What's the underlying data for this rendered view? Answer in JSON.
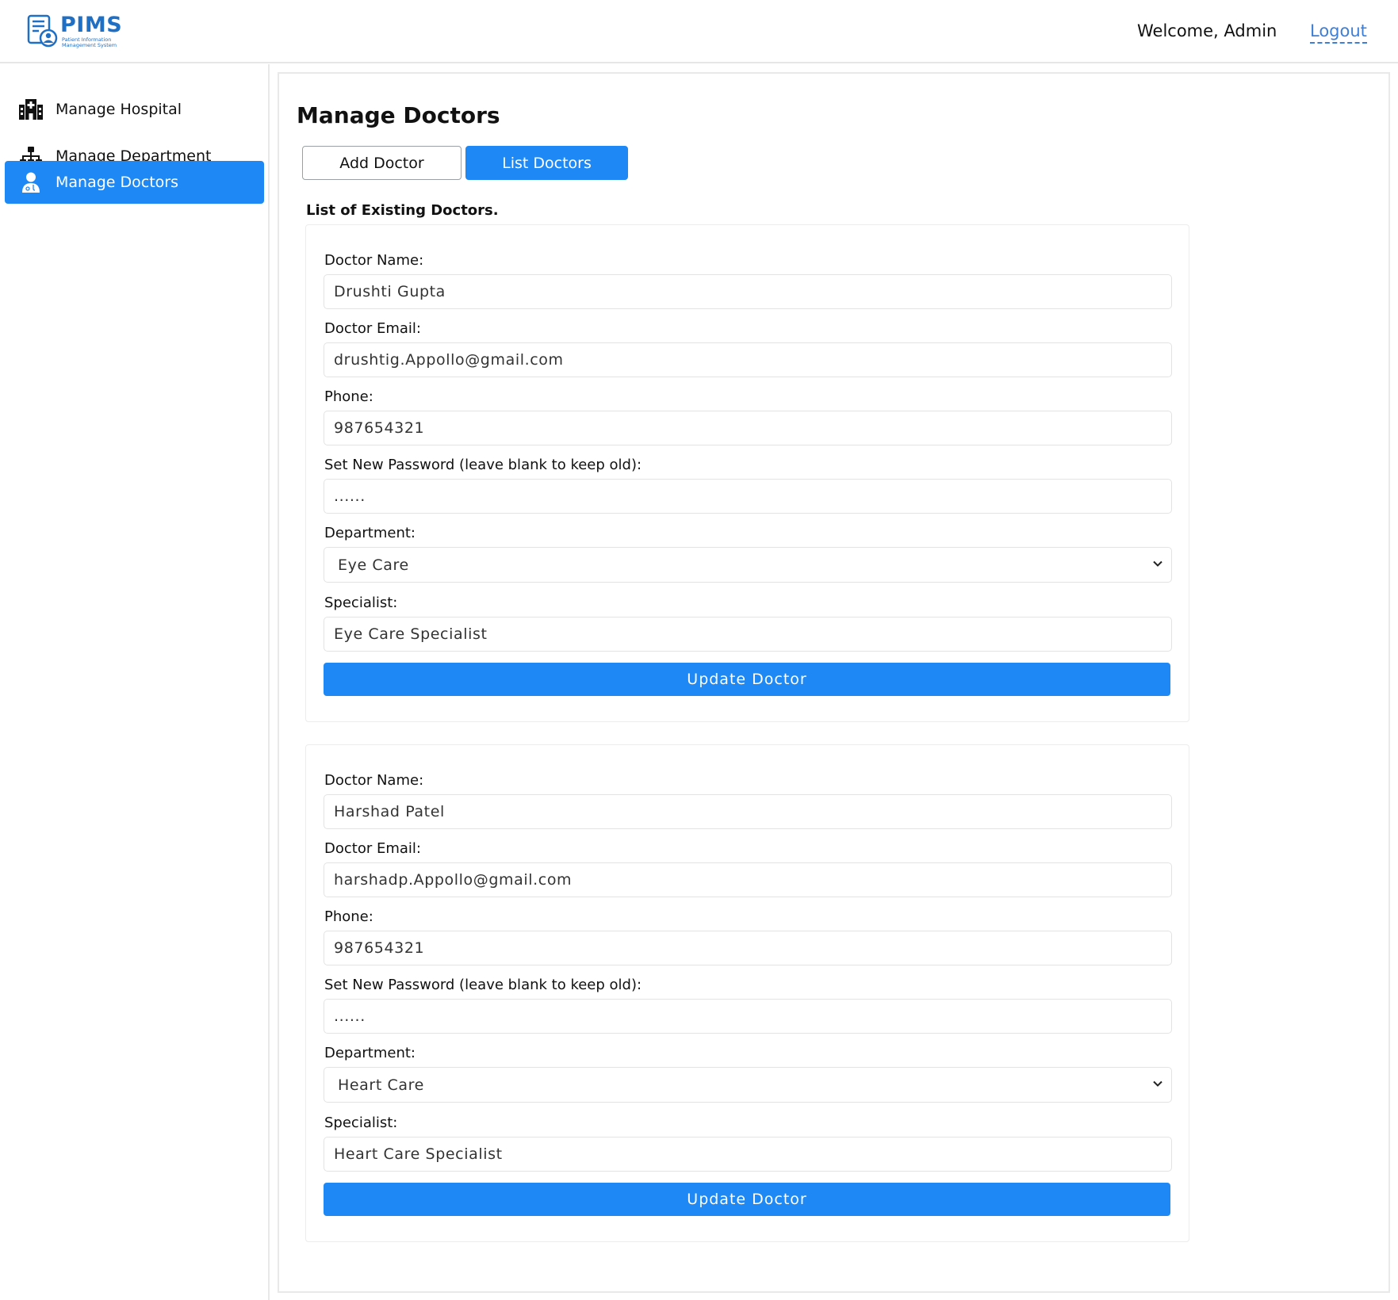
{
  "header": {
    "logo_text": "PIMS",
    "logo_subtitle": "Patient Information Management System",
    "welcome_text": "Welcome, Admin",
    "logout_label": "Logout"
  },
  "sidebar": {
    "items": [
      {
        "label": "Manage Hospital",
        "icon": "hospital-icon",
        "active": false
      },
      {
        "label": "Manage Department",
        "icon": "sitemap-icon",
        "active": false
      },
      {
        "label": "Manage Doctors",
        "icon": "doctor-icon",
        "active": true
      }
    ]
  },
  "main": {
    "title": "Manage Doctors",
    "tabs": [
      {
        "label": "Add Doctor",
        "active": false
      },
      {
        "label": "List Doctors",
        "active": true
      }
    ],
    "list_heading": "List of Existing Doctors.",
    "field_labels": {
      "name": "Doctor Name:",
      "email": "Doctor Email:",
      "phone": "Phone:",
      "password": "Set New Password (leave blank to keep old):",
      "department": "Department:",
      "specialist": "Specialist:"
    },
    "update_label": "Update Doctor",
    "doctors": [
      {
        "name": "Drushti Gupta",
        "email": "drushtig.Appollo@gmail.com",
        "phone": "987654321",
        "password_mask": "......",
        "department": "Eye Care",
        "specialist": "Eye Care Specialist"
      },
      {
        "name": "Harshad Patel",
        "email": "harshadp.Appollo@gmail.com",
        "phone": "987654321",
        "password_mask": "......",
        "department": "Heart Care",
        "specialist": "Heart Care Specialist"
      }
    ]
  },
  "colors": {
    "accent": "#1e88f5",
    "logo_blue": "#1f6fc4",
    "link": "#3d7fd8"
  }
}
